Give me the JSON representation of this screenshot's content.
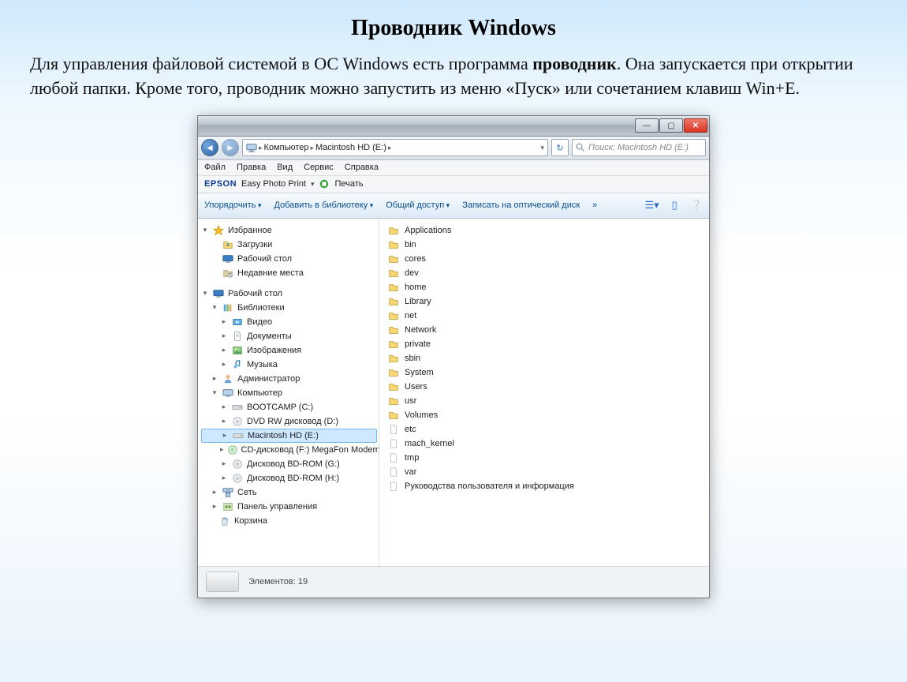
{
  "page": {
    "title": "Проводник Windows",
    "description_prefix": "Для управления файловой системой в ОС Windows есть программа ",
    "description_bold": "проводник",
    "description_suffix": ". Она запускается при открытии любой папки. Кроме того, проводник можно запустить из меню «Пуск» или сочетанием клавиш Win+E."
  },
  "explorer": {
    "path_segments": [
      "Компьютер",
      "Macintosh HD (E:)"
    ],
    "search_placeholder": "Поиск: Macintosh HD (E:)",
    "menu": [
      "Файл",
      "Правка",
      "Вид",
      "Сервис",
      "Справка"
    ],
    "epson": {
      "brand": "EPSON",
      "label": "Easy Photo Print",
      "print": "Печать"
    },
    "toolbar": {
      "organize": "Упорядочить",
      "add_library": "Добавить в библиотеку",
      "share": "Общий доступ",
      "burn": "Записать на оптический диск",
      "more": "»"
    },
    "tree": {
      "favorites": {
        "label": "Избранное",
        "items": [
          "Загрузки",
          "Рабочий стол",
          "Недавние места"
        ]
      },
      "desktop": "Рабочий стол",
      "libraries": {
        "label": "Библиотеки",
        "items": [
          "Видео",
          "Документы",
          "Изображения",
          "Музыка"
        ]
      },
      "admin": "Администратор",
      "computer": {
        "label": "Компьютер",
        "items": [
          "BOOTCAMP (C:)",
          "DVD RW дисковод (D:)",
          "Macintosh HD (E:)",
          "CD-дисковод (F:) MegaFon Modem",
          "Дисковод BD-ROM (G:)",
          "Дисковод BD-ROM (H:)"
        ]
      },
      "network": "Сеть",
      "control_panel": "Панель управления",
      "recycle": "Корзина"
    },
    "list": [
      {
        "name": "Applications",
        "type": "folder"
      },
      {
        "name": "bin",
        "type": "folder"
      },
      {
        "name": "cores",
        "type": "folder"
      },
      {
        "name": "dev",
        "type": "folder"
      },
      {
        "name": "home",
        "type": "folder"
      },
      {
        "name": "Library",
        "type": "folder"
      },
      {
        "name": "net",
        "type": "folder"
      },
      {
        "name": "Network",
        "type": "folder"
      },
      {
        "name": "private",
        "type": "folder"
      },
      {
        "name": "sbin",
        "type": "folder"
      },
      {
        "name": "System",
        "type": "folder"
      },
      {
        "name": "Users",
        "type": "folder"
      },
      {
        "name": "usr",
        "type": "folder"
      },
      {
        "name": "Volumes",
        "type": "folder"
      },
      {
        "name": "etc",
        "type": "file"
      },
      {
        "name": "mach_kernel",
        "type": "file"
      },
      {
        "name": "tmp",
        "type": "file"
      },
      {
        "name": "var",
        "type": "file"
      },
      {
        "name": "Руководства пользователя и информация",
        "type": "file"
      }
    ],
    "status": "Элементов: 19"
  }
}
